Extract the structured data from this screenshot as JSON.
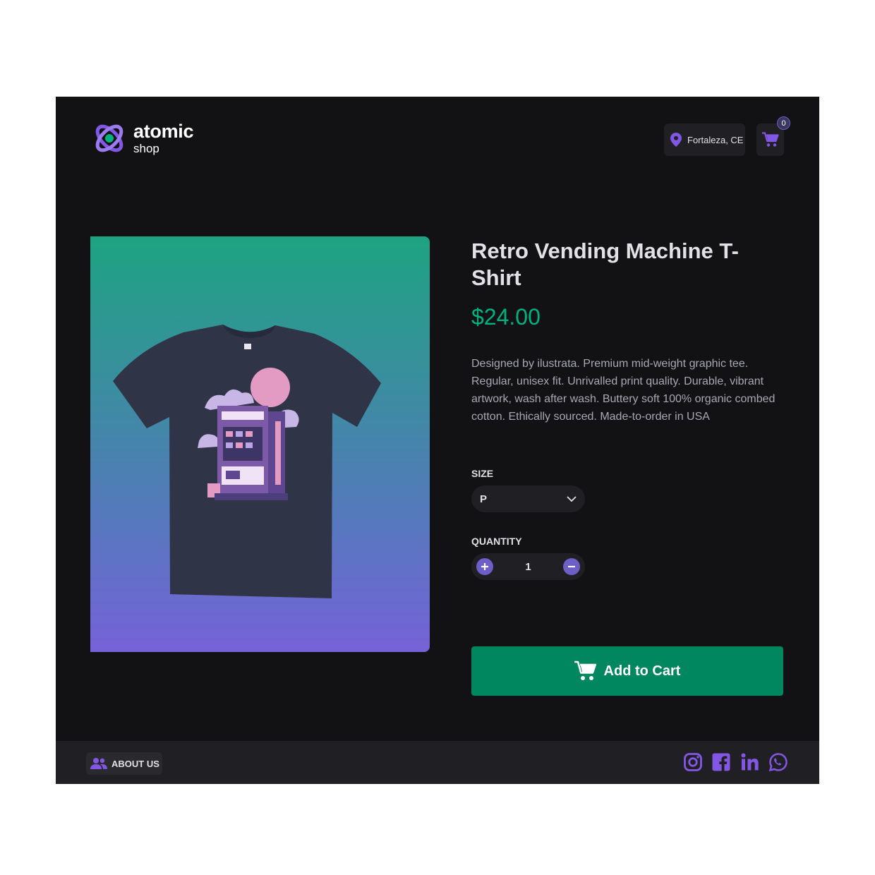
{
  "brand": {
    "name": "atomic",
    "sub": "shop"
  },
  "header": {
    "location": "Fortaleza, CE",
    "cart_count": "0"
  },
  "product": {
    "title": "Retro Vending Machine T-Shirt",
    "price": "$24.00",
    "description": "Designed by ilustrata. Premium mid-weight graphic tee. Regular, unisex fit. Unrivalled print quality. Durable, vibrant artwork, wash after wash. Buttery soft 100% organic combed cotton. Ethically sourced. Made-to-order in USA",
    "size_label": "SIZE",
    "size_value": "P",
    "quantity_label": "QUANTITY",
    "quantity_value": "1",
    "add_to_cart": "Add to Cart"
  },
  "footer": {
    "about": "ABOUT US",
    "social": [
      "instagram-icon",
      "facebook-icon",
      "linkedin-icon",
      "whatsapp-icon"
    ]
  },
  "colors": {
    "background": "#121214",
    "surface": "#202024",
    "accent": "#8257e5",
    "price": "#00b37e",
    "button": "#00875f"
  }
}
